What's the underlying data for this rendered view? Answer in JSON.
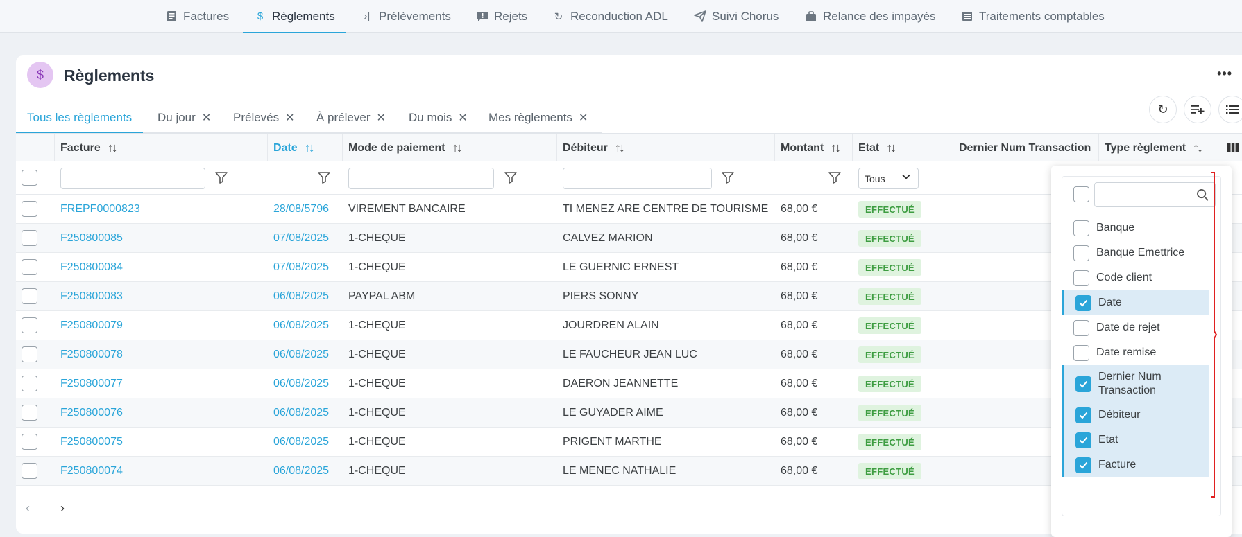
{
  "topnav": {
    "items": [
      {
        "label": "Factures",
        "icon": "invoice-icon"
      },
      {
        "label": "Règlements",
        "icon": "dollar-icon",
        "active": true
      },
      {
        "label": "Prélèvements",
        "icon": "chevron-bar-icon"
      },
      {
        "label": "Rejets",
        "icon": "alert-message-icon"
      },
      {
        "label": "Reconduction ADL",
        "icon": "refresh-icon"
      },
      {
        "label": "Suivi Chorus",
        "icon": "paper-plane-icon"
      },
      {
        "label": "Relance des impayés",
        "icon": "briefcase-icon"
      },
      {
        "label": "Traitements comptables",
        "icon": "list-icon"
      }
    ]
  },
  "page": {
    "title": "Règlements",
    "avatar_symbol": "$",
    "avatar_color": "#e4c6f2"
  },
  "tabs": [
    {
      "label": "Tous les règlements",
      "active": true
    },
    {
      "label": "Du jour"
    },
    {
      "label": "Prélevés"
    },
    {
      "label": "À prélever"
    },
    {
      "label": "Du mois"
    },
    {
      "label": "Mes règlements"
    }
  ],
  "table": {
    "headers": {
      "facture": "Facture",
      "date": "Date",
      "mode": "Mode de paiement",
      "debiteur": "Débiteur",
      "montant": "Montant",
      "etat": "Etat",
      "dernier": "Dernier Num Transaction",
      "type": "Type règlement"
    },
    "etat_filter": "Tous",
    "rows": [
      {
        "facture": "FREPF0000823",
        "date": "28/08/5796",
        "mode": "VIREMENT BANCAIRE",
        "debiteur": "TI MENEZ ARE CENTRE DE TOURISME",
        "montant": "68,00 €",
        "etat": "EFFECTUÉ"
      },
      {
        "facture": "F250800085",
        "date": "07/08/2025",
        "mode": "1-CHEQUE",
        "debiteur": "CALVEZ MARION",
        "montant": "68,00 €",
        "etat": "EFFECTUÉ"
      },
      {
        "facture": "F250800084",
        "date": "07/08/2025",
        "mode": "1-CHEQUE",
        "debiteur": "LE GUERNIC ERNEST",
        "montant": "68,00 €",
        "etat": "EFFECTUÉ"
      },
      {
        "facture": "F250800083",
        "date": "06/08/2025",
        "mode": "PAYPAL ABM",
        "debiteur": "PIERS SONNY",
        "montant": "68,00 €",
        "etat": "EFFECTUÉ"
      },
      {
        "facture": "F250800079",
        "date": "06/08/2025",
        "mode": "1-CHEQUE",
        "debiteur": "JOURDREN ALAIN",
        "montant": "68,00 €",
        "etat": "EFFECTUÉ"
      },
      {
        "facture": "F250800078",
        "date": "06/08/2025",
        "mode": "1-CHEQUE",
        "debiteur": "LE FAUCHEUR JEAN LUC",
        "montant": "68,00 €",
        "etat": "EFFECTUÉ"
      },
      {
        "facture": "F250800077",
        "date": "06/08/2025",
        "mode": "1-CHEQUE",
        "debiteur": "DAERON JEANNETTE",
        "montant": "68,00 €",
        "etat": "EFFECTUÉ"
      },
      {
        "facture": "F250800076",
        "date": "06/08/2025",
        "mode": "1-CHEQUE",
        "debiteur": "LE GUYADER AIME",
        "montant": "68,00 €",
        "etat": "EFFECTUÉ"
      },
      {
        "facture": "F250800075",
        "date": "06/08/2025",
        "mode": "1-CHEQUE",
        "debiteur": "PRIGENT MARTHE",
        "montant": "68,00 €",
        "etat": "EFFECTUÉ"
      },
      {
        "facture": "F250800074",
        "date": "06/08/2025",
        "mode": "1-CHEQUE",
        "debiteur": "LE MENEC NATHALIE",
        "montant": "68,00 €",
        "etat": "EFFECTUÉ"
      }
    ]
  },
  "pagination": {
    "prev": "‹",
    "next": "›"
  },
  "column_chooser": {
    "items": [
      {
        "label": "Banque",
        "checked": false
      },
      {
        "label": "Banque Emettrice",
        "checked": false
      },
      {
        "label": "Code client",
        "checked": false
      },
      {
        "label": "Date",
        "checked": true
      },
      {
        "label": "Date de rejet",
        "checked": false
      },
      {
        "label": "Date remise",
        "checked": false
      },
      {
        "label": "Dernier Num Transaction",
        "checked": true
      },
      {
        "label": "Débiteur",
        "checked": true
      },
      {
        "label": "Etat",
        "checked": true
      },
      {
        "label": "Facture",
        "checked": true
      }
    ]
  },
  "colors": {
    "accent": "#2aa5d9",
    "badge_bg": "#dff3df",
    "badge_text": "#3e9d42",
    "annotation": "#e02020"
  }
}
